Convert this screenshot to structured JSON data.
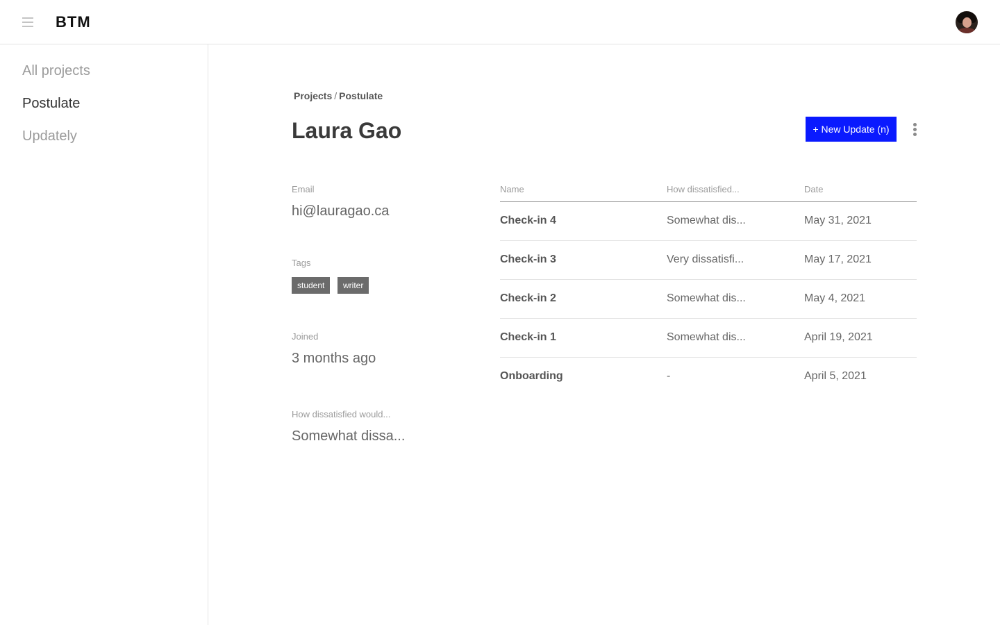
{
  "header": {
    "brand": "BTM"
  },
  "sidebar": {
    "items": [
      {
        "label": "All projects"
      },
      {
        "label": "Postulate"
      },
      {
        "label": "Updately"
      }
    ]
  },
  "breadcrumb": {
    "root": "Projects",
    "separator": "/",
    "current": "Postulate"
  },
  "page": {
    "title": "Laura Gao"
  },
  "actions": {
    "new_update_label": "+ New Update (n)"
  },
  "details": {
    "email_label": "Email",
    "email": "hi@lauragao.ca",
    "tags_label": "Tags",
    "tags": [
      "student",
      "writer"
    ],
    "joined_label": "Joined",
    "joined": "3 months ago",
    "dissatisfied_label": "How dissatisfied would...",
    "dissatisfied": "Somewhat dissa..."
  },
  "table": {
    "columns": [
      "Name",
      "How dissatisfied...",
      "Date"
    ],
    "rows": [
      {
        "name": "Check-in 4",
        "dissatisfied": "Somewhat dis...",
        "date": "May 31, 2021"
      },
      {
        "name": "Check-in 3",
        "dissatisfied": "Very dissatisfi...",
        "date": "May 17, 2021"
      },
      {
        "name": "Check-in 2",
        "dissatisfied": "Somewhat dis...",
        "date": "May 4, 2021"
      },
      {
        "name": "Check-in 1",
        "dissatisfied": "Somewhat dis...",
        "date": "April 19, 2021"
      },
      {
        "name": "Onboarding",
        "dissatisfied": "-",
        "date": "April 5, 2021"
      }
    ]
  },
  "colors": {
    "primary_button": "#0a1aff",
    "tag_background": "#6b6b6b",
    "divider": "#e3e3e3"
  },
  "icons": [
    "menu-icon",
    "avatar",
    "more-vertical-icon"
  ]
}
